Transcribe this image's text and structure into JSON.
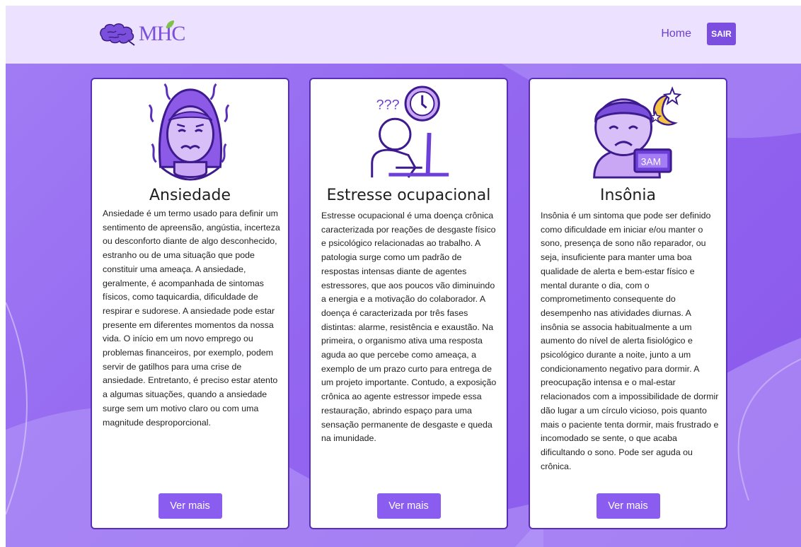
{
  "navbar": {
    "logo_text": "MHC",
    "home_label": "Home",
    "logout_label": "SAIR"
  },
  "cards": [
    {
      "title": "Ansiedade",
      "icon": "anxious-woman-icon",
      "text": "Ansiedade é um termo usado para definir um sentimento de apreensão, angústia, incerteza ou desconforto diante de algo desconhecido, estranho ou de uma situação que pode constituir uma ameaça. A ansiedade, geralmente, é acompanhada de sintomas físicos, como taquicardia, dificuldade de respirar e sudorese. A ansiedade pode estar presente em diferentes momentos da nossa vida. O início em um novo emprego ou problemas financeiros, por exemplo, podem servir de gatilhos para uma crise de ansiedade. Entretanto, é preciso estar atento a algumas situações, quando a ansiedade surge sem um motivo claro ou com uma magnitude desproporcional.",
      "button": "Ver mais"
    },
    {
      "title": "Estresse ocupacional",
      "icon": "stressed-worker-icon",
      "art_text": "???",
      "text": "Estresse ocupacional é uma doença crônica caracterizada por reações de desgaste físico e psicológico relacionadas ao trabalho. A patologia surge como um padrão de respostas intensas diante de agentes estressores, que aos poucos vão diminuindo a energia e a motivação do colaborador. A doença é caracterizada por três fases distintas: alarme, resistência e exaustão. Na primeira, o organismo ativa uma resposta aguda ao que percebe como ameaça, a exemplo de um prazo curto para entrega de um projeto importante. Contudo, a exposição crônica ao agente estressor impede essa restauração, abrindo espaço para uma sensação permanente de desgaste e queda na imunidade.",
      "button": "Ver mais"
    },
    {
      "title": "Insônia",
      "icon": "sleepless-boy-icon",
      "art_text": "3AM",
      "text": "Insônia é um sintoma que pode ser definido como dificuldade em iniciar e/ou manter o sono, presença de sono não reparador, ou seja, insuficiente para manter uma boa qualidade de alerta e bem-estar físico e mental durante o dia, com o comprometimento consequente do desempenho nas atividades diurnas. A insônia se associa habitualmente a um aumento do nível de alerta fisiológico e psicológico durante a noite, junto a um condicionamento negativo para dormir. A preocupação intensa e o mal-estar relacionados com a impossibilidade de dormir dão lugar a um círculo vicioso, pois quanto mais o paciente tenta dormir, mais frustrado e incomodado se sente, o que acaba dificultando o sono. Pode ser aguda ou crônica.",
      "button": "Ver mais"
    }
  ]
}
